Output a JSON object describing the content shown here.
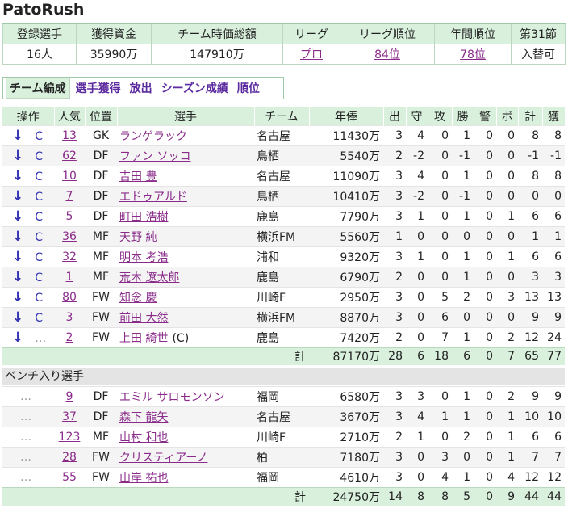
{
  "app": {
    "title": "PatoRush"
  },
  "summary": {
    "headers": [
      "登録選手",
      "獲得資金",
      "チーム時価総額",
      "リーグ",
      "リーグ順位",
      "年間順位",
      "第31節"
    ],
    "values": [
      "16人",
      "35990万",
      "147910万",
      "プロ",
      "84位",
      "78位",
      "入替可"
    ]
  },
  "tabs": [
    "チーム編成",
    "選手獲得",
    "放出",
    "シーズン成績",
    "順位"
  ],
  "roster": {
    "columns": [
      "操作",
      "人気",
      "位置",
      "選手",
      "チーム",
      "年俸",
      "出",
      "守",
      "攻",
      "勝",
      "警",
      "ボ",
      "計",
      "獲"
    ],
    "starters": [
      {
        "op": "↓",
        "c": "C",
        "pop": "13",
        "pos": "GK",
        "name": "ランゲラック",
        "team": "名古屋",
        "salary": "11430万",
        "s1": "3",
        "s2": "4",
        "s3": "0",
        "s4": "1",
        "s5": "0",
        "s6": "0",
        "s7": "8",
        "s8": "8"
      },
      {
        "op": "↓",
        "c": "C",
        "pop": "62",
        "pos": "DF",
        "name": "ファン ソッコ",
        "team": "鳥栖",
        "salary": "5540万",
        "s1": "2",
        "s2": "-2",
        "s3": "0",
        "s4": "-1",
        "s5": "0",
        "s6": "0",
        "s7": "-1",
        "s8": "-1"
      },
      {
        "op": "↓",
        "c": "C",
        "pop": "10",
        "pos": "DF",
        "name": "吉田 豊",
        "team": "名古屋",
        "salary": "11090万",
        "s1": "3",
        "s2": "4",
        "s3": "0",
        "s4": "1",
        "s5": "0",
        "s6": "0",
        "s7": "8",
        "s8": "8"
      },
      {
        "op": "↓",
        "c": "C",
        "pop": "7",
        "pos": "DF",
        "name": "エドゥアルド",
        "team": "鳥栖",
        "salary": "10410万",
        "s1": "3",
        "s2": "-2",
        "s3": "0",
        "s4": "-1",
        "s5": "0",
        "s6": "0",
        "s7": "0",
        "s8": "0"
      },
      {
        "op": "↓",
        "c": "C",
        "pop": "5",
        "pos": "DF",
        "name": "町田 浩樹",
        "team": "鹿島",
        "salary": "7790万",
        "s1": "3",
        "s2": "1",
        "s3": "0",
        "s4": "1",
        "s5": "0",
        "s6": "1",
        "s7": "6",
        "s8": "6"
      },
      {
        "op": "↓",
        "c": "C",
        "pop": "36",
        "pos": "MF",
        "name": "天野 純",
        "team": "横浜FM",
        "salary": "5560万",
        "s1": "1",
        "s2": "0",
        "s3": "0",
        "s4": "0",
        "s5": "0",
        "s6": "0",
        "s7": "1",
        "s8": "1"
      },
      {
        "op": "↓",
        "c": "C",
        "pop": "32",
        "pos": "MF",
        "name": "明本 考浩",
        "team": "浦和",
        "salary": "9320万",
        "s1": "3",
        "s2": "1",
        "s3": "0",
        "s4": "1",
        "s5": "0",
        "s6": "1",
        "s7": "6",
        "s8": "6"
      },
      {
        "op": "↓",
        "c": "C",
        "pop": "1",
        "pos": "MF",
        "name": "荒木 遼太郎",
        "team": "鹿島",
        "salary": "6790万",
        "s1": "2",
        "s2": "0",
        "s3": "0",
        "s4": "1",
        "s5": "0",
        "s6": "0",
        "s7": "3",
        "s8": "3"
      },
      {
        "op": "↓",
        "c": "C",
        "pop": "80",
        "pos": "FW",
        "name": "知念 慶",
        "team": "川崎F",
        "salary": "2950万",
        "s1": "3",
        "s2": "0",
        "s3": "5",
        "s4": "2",
        "s5": "0",
        "s6": "3",
        "s7": "13",
        "s8": "13"
      },
      {
        "op": "↓",
        "c": "C",
        "pop": "3",
        "pos": "FW",
        "name": "前田 大然",
        "team": "横浜FM",
        "salary": "8870万",
        "s1": "3",
        "s2": "0",
        "s3": "6",
        "s4": "0",
        "s5": "0",
        "s6": "0",
        "s7": "9",
        "s8": "9"
      },
      {
        "op": "↓",
        "c": "…",
        "pop": "2",
        "pos": "FW",
        "name": "上田 綺世",
        "suffix": "(C)",
        "team": "鹿島",
        "salary": "7420万",
        "s1": "2",
        "s2": "0",
        "s3": "7",
        "s4": "1",
        "s5": "0",
        "s6": "2",
        "s7": "12",
        "s8": "24"
      }
    ],
    "starters_total": {
      "label": "計",
      "salary": "87170万",
      "s1": "28",
      "s2": "6",
      "s3": "18",
      "s4": "6",
      "s5": "0",
      "s6": "7",
      "s7": "65",
      "s8": "77"
    },
    "bench_title": "ベンチ入り選手",
    "bench": [
      {
        "op": "…",
        "pop": "9",
        "pos": "DF",
        "name": "エミル サロモンソン",
        "team": "福岡",
        "salary": "6580万",
        "s1": "3",
        "s2": "3",
        "s3": "0",
        "s4": "1",
        "s5": "0",
        "s6": "2",
        "s7": "9",
        "s8": "9"
      },
      {
        "op": "…",
        "pop": "37",
        "pos": "DF",
        "name": "森下 龍矢",
        "team": "名古屋",
        "salary": "3670万",
        "s1": "3",
        "s2": "4",
        "s3": "1",
        "s4": "1",
        "s5": "0",
        "s6": "1",
        "s7": "10",
        "s8": "10"
      },
      {
        "op": "…",
        "pop": "123",
        "pos": "MF",
        "name": "山村 和也",
        "team": "川崎F",
        "salary": "2710万",
        "s1": "2",
        "s2": "1",
        "s3": "0",
        "s4": "2",
        "s5": "0",
        "s6": "1",
        "s7": "6",
        "s8": "6"
      },
      {
        "op": "…",
        "pop": "28",
        "pos": "FW",
        "name": "クリスティアーノ",
        "team": "柏",
        "salary": "7180万",
        "s1": "3",
        "s2": "0",
        "s3": "3",
        "s4": "0",
        "s5": "0",
        "s6": "1",
        "s7": "7",
        "s8": "7"
      },
      {
        "op": "…",
        "pop": "55",
        "pos": "FW",
        "name": "山岸 祐也",
        "team": "福岡",
        "salary": "4610万",
        "s1": "3",
        "s2": "0",
        "s3": "4",
        "s4": "1",
        "s5": "0",
        "s6": "4",
        "s7": "12",
        "s8": "12"
      }
    ],
    "bench_total": {
      "label": "計",
      "salary": "24750万",
      "s1": "14",
      "s2": "8",
      "s3": "8",
      "s4": "5",
      "s5": "0",
      "s6": "9",
      "s7": "44",
      "s8": "44"
    }
  }
}
